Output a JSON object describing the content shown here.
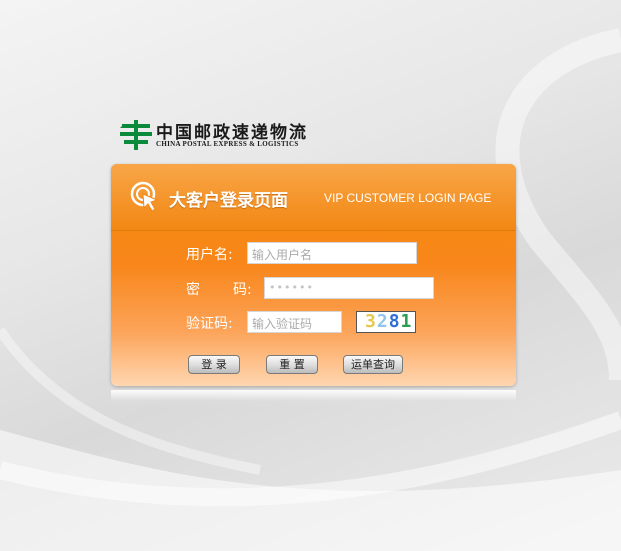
{
  "logo": {
    "name_cn": "中国邮政速递物流",
    "name_en": "CHINA POSTAL EXPRESS & LOGISTICS"
  },
  "panel": {
    "title_cn": "大客户登录页面",
    "title_en": "VIP CUSTOMER LOGIN PAGE"
  },
  "form": {
    "username_label": "用户名:",
    "username_placeholder": "输入用户名",
    "password_label_first": "密",
    "password_label_second": "码:",
    "password_masked": "••••••",
    "captcha_label": "验证码:",
    "captcha_placeholder": "输入验证码",
    "captcha_chars": [
      "3",
      "2",
      "8",
      "1"
    ],
    "captcha_colors": [
      "#e6c84c",
      "#8fc6e8",
      "#2f6fd6",
      "#2c9c4f"
    ]
  },
  "buttons": {
    "login": "登 录",
    "reset": "重 置",
    "track": "运单查询"
  },
  "colors": {
    "brand_green": "#0a8a3a",
    "panel_orange": "#f68a14"
  }
}
